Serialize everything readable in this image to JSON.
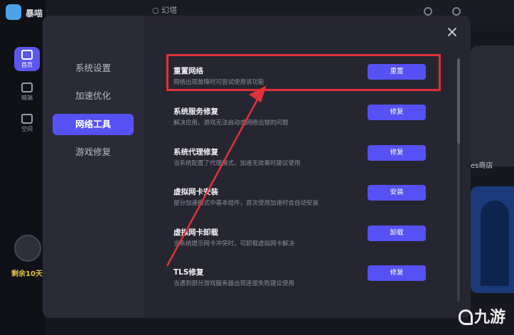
{
  "background": {
    "app_name": "暴喵",
    "search_value": "幻塔",
    "nav": [
      {
        "label": "首页",
        "active": true
      },
      {
        "label": "暗端",
        "active": false
      },
      {
        "label": "空间",
        "active": false
      }
    ],
    "days_left": "剩余10天",
    "store_label": "es商店"
  },
  "settings": {
    "menu": [
      "系统设置",
      "加速优化",
      "网络工具",
      "游戏修复"
    ],
    "active_menu_index": 2,
    "items": [
      {
        "title": "重置网络",
        "desc": "网络出现故障时可尝试使用该功能",
        "button": "重置"
      },
      {
        "title": "系统服务修复",
        "desc": "解决应用、游戏无法启动或网络出错的问题",
        "button": "修复"
      },
      {
        "title": "系统代理修复",
        "desc": "当系统配置了代理模式，加速无效果时建议使用",
        "button": "修复"
      },
      {
        "title": "虚拟网卡安装",
        "desc": "部分加速模式中基本组件，首次使用加速时会自动安装",
        "button": "安装"
      },
      {
        "title": "虚拟网卡卸载",
        "desc": "当系统提示网卡冲突时，可卸载虚拟网卡解决",
        "button": "卸载"
      },
      {
        "title": "TLS修复",
        "desc": "当遇到部分游戏服务器出现连接失败建议使用",
        "button": "修复"
      }
    ]
  },
  "annotation_color": "#e0303a",
  "accent_color": "#5651f2",
  "watermark": "九游"
}
